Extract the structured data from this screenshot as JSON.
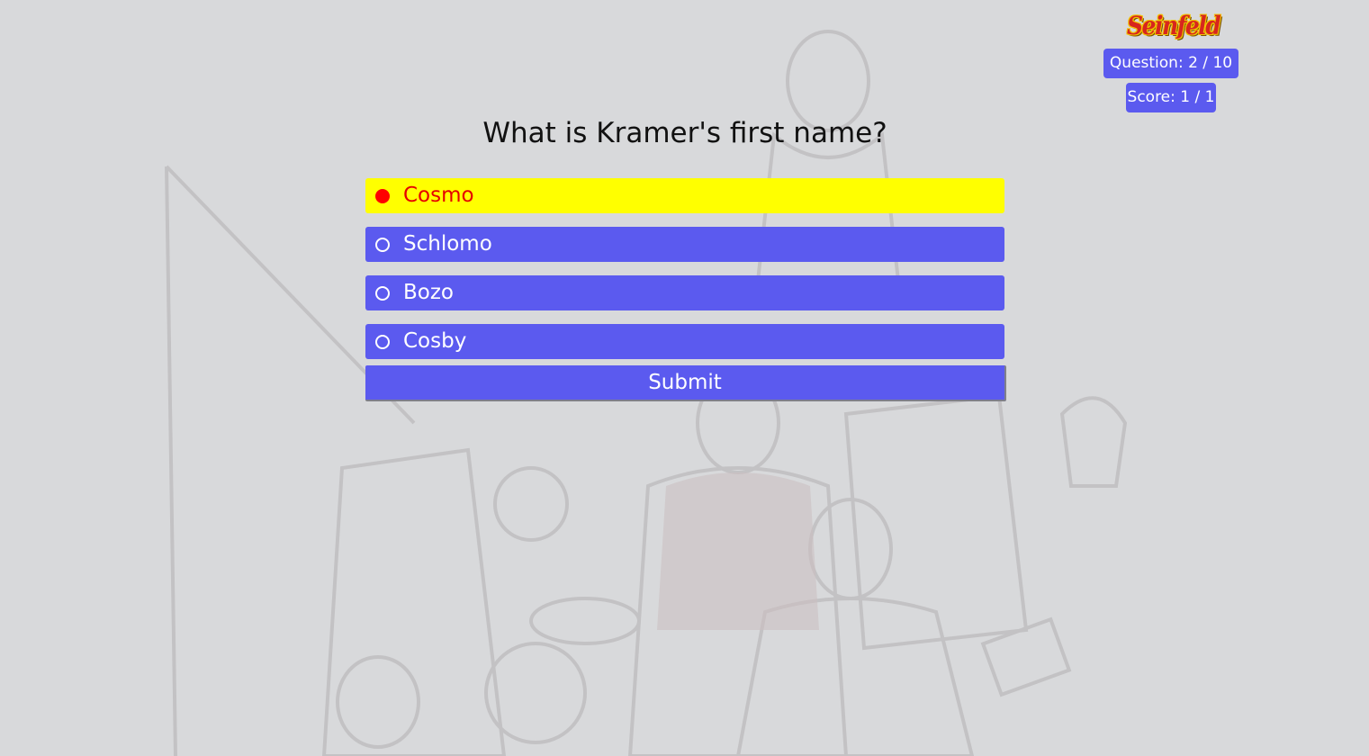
{
  "header": {
    "logo_text": "Seinfeld",
    "question_counter": "Question: 2 / 10",
    "score": "Score: 1 / 1"
  },
  "quiz": {
    "question": "What is Kramer's first name?",
    "answers": [
      {
        "label": "Cosmo",
        "selected": true
      },
      {
        "label": "Schlomo",
        "selected": false
      },
      {
        "label": "Bozo",
        "selected": false
      },
      {
        "label": "Cosby",
        "selected": false
      }
    ],
    "submit_label": "Submit"
  },
  "colors": {
    "background": "#d8d9db",
    "accent": "#5b5aef",
    "selected_background": "#ffff00",
    "selected_text": "#e60000",
    "radio_selected": "#ff0000"
  }
}
